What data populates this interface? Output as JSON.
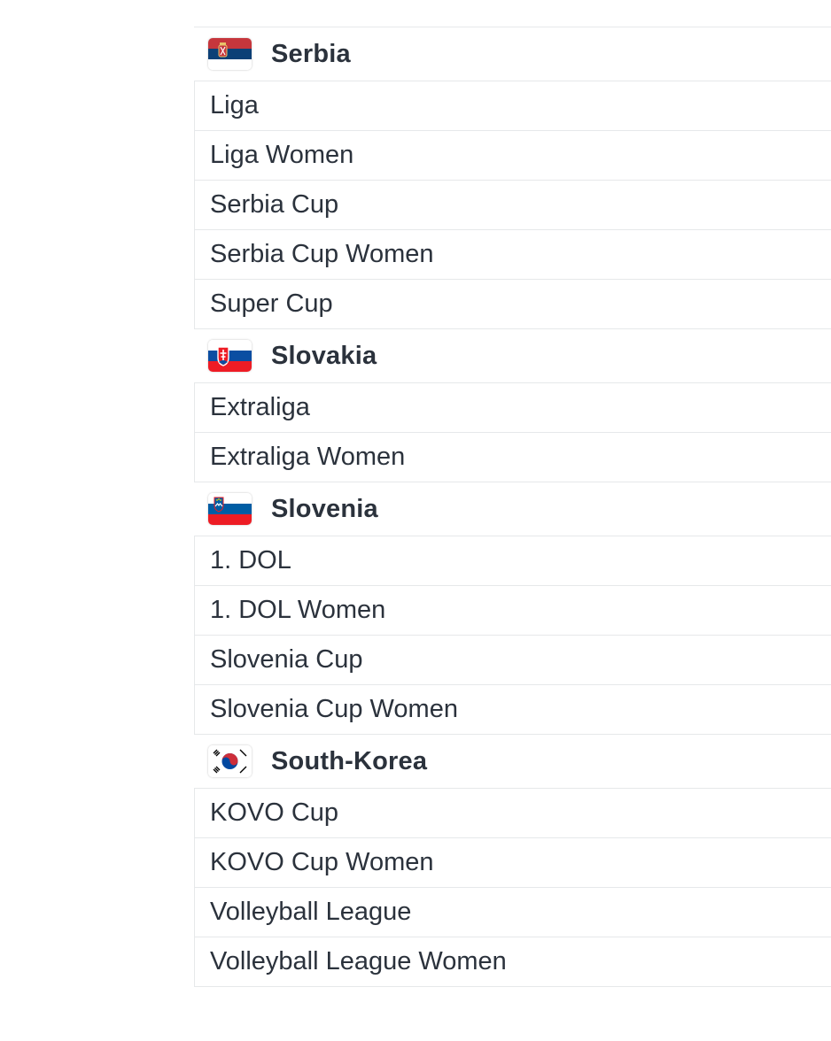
{
  "countries": [
    {
      "name": "Serbia",
      "flag": {
        "icon": "serbia-flag-icon",
        "colors": [
          "#c6363c",
          "#0c4076",
          "#ffffff"
        ]
      },
      "leagues": [
        "Liga",
        "Liga Women",
        "Serbia Cup",
        "Serbia Cup Women",
        "Super Cup"
      ]
    },
    {
      "name": "Slovakia",
      "flag": {
        "icon": "slovakia-flag-icon",
        "colors": [
          "#ffffff",
          "#0b4ea2",
          "#ee1c25"
        ]
      },
      "leagues": [
        "Extraliga",
        "Extraliga Women"
      ]
    },
    {
      "name": "Slovenia",
      "flag": {
        "icon": "slovenia-flag-icon",
        "colors": [
          "#ffffff",
          "#005da4",
          "#ed1c24"
        ]
      },
      "leagues": [
        "1. DOL",
        "1. DOL Women",
        "Slovenia Cup",
        "Slovenia Cup Women"
      ]
    },
    {
      "name": "South-Korea",
      "flag": {
        "icon": "south-korea-flag-icon",
        "colors": [
          "#ffffff",
          "#cd2e3a",
          "#0047a0",
          "#000000"
        ]
      },
      "leagues": [
        "KOVO Cup",
        "KOVO Cup Women",
        "Volleyball League",
        "Volleyball League Women"
      ]
    }
  ]
}
